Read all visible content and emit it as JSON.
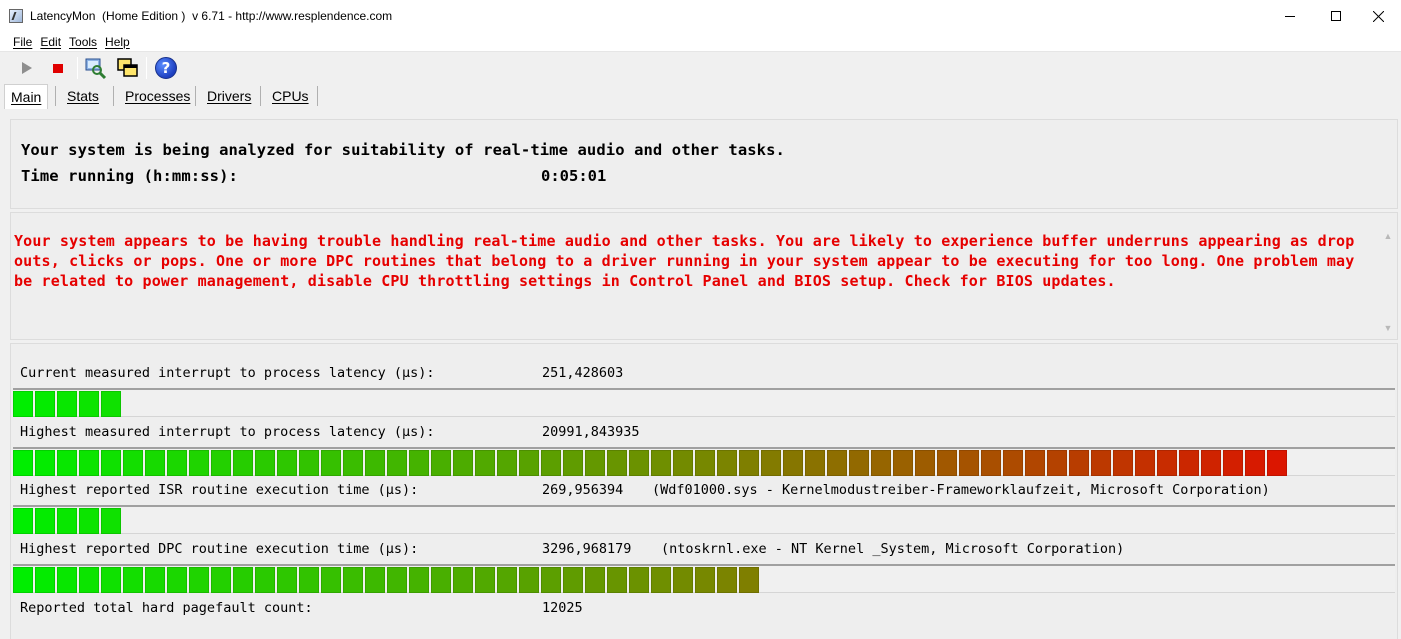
{
  "window": {
    "title": "LatencyMon  (Home Edition )  v 6.71 - http://www.resplendence.com"
  },
  "menu": {
    "items": [
      "File",
      "Edit",
      "Tools",
      "Help"
    ]
  },
  "toolbar": {
    "icons": [
      "play-icon",
      "stop-icon",
      "inspect-icon",
      "windows-icon",
      "help-icon"
    ]
  },
  "tabs": [
    "Main",
    "Stats",
    "Processes",
    "Drivers",
    "CPUs"
  ],
  "status": {
    "line1": "Your system is being analyzed for suitability of real-time audio and other tasks.",
    "time_label": "Time running (h:mm:ss):",
    "time_value": "0:05:01"
  },
  "warning": {
    "text": "Your system appears to be having trouble handling real-time audio and other tasks. You are likely to experience buffer underruns appearing as drop outs, clicks or pops. One or more DPC routines that belong to a driver running in your system appear to be executing for too long. One problem may be related to power management, disable CPU throttling settings in Control Panel and BIOS setup. Check for BIOS updates.",
    "color": "#e60000"
  },
  "metrics": [
    {
      "label": "Current measured interrupt to process latency (µs):",
      "value": "251,428603",
      "extra": "",
      "segments": 5
    },
    {
      "label": "Highest measured interrupt to process latency (µs):",
      "value": "20991,843935",
      "extra": "",
      "segments": 58
    },
    {
      "label": "Highest reported ISR routine execution time (µs):",
      "value": "269,956394",
      "extra": "(Wdf01000.sys - Kernelmodustreiber-Frameworklaufzeit, Microsoft Corporation)",
      "segments": 5
    },
    {
      "label": "Highest reported DPC routine execution time (µs):",
      "value": "3296,968179",
      "extra": "(ntoskrnl.exe - NT Kernel _System, Microsoft Corporation)",
      "segments": 34
    },
    {
      "label": "Reported total hard pagefault count:",
      "value": "12025",
      "extra": ""
    }
  ],
  "colors": {
    "bar_start": "#00ee00",
    "bar_end": "#ee0000"
  }
}
